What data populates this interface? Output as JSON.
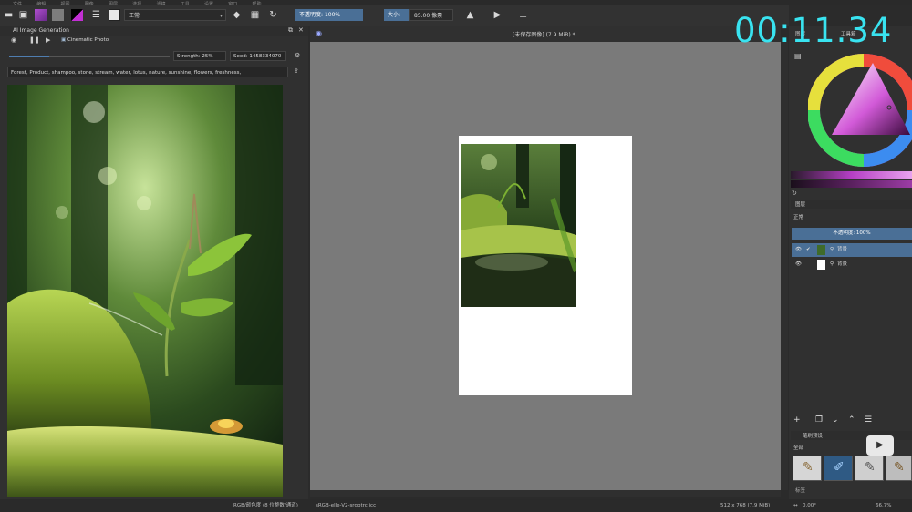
{
  "menubar": {
    "items": [
      "文件",
      "编辑",
      "视图",
      "图像",
      "图层",
      "选择",
      "滤镜",
      "工具",
      "设置",
      "窗口",
      "帮助"
    ]
  },
  "toolbar": {
    "blend_mode": "正常",
    "opacity_label": "不透明度:",
    "opacity_value": "100%",
    "size_label": "大小:",
    "size_value": "85.00 像素"
  },
  "ai_docker": {
    "title": "AI Image Generation",
    "style": "Cinematic Photo",
    "strength": "Strength: 25%",
    "seed": "Seed: 1458334070",
    "prompt": "Forest, Product, shampoo, stone, stream, water, lotus, nature, sunshine, flowers, freshness,"
  },
  "canvas": {
    "title": "[未保存图像]  (7.9 MiB) *"
  },
  "timer": "00:11.34",
  "right_panel": {
    "top_tabs": [
      "图层",
      "工具箱"
    ],
    "layers_title": "图层",
    "blend_mode": "正常",
    "opacity": "不透明度: 100%",
    "layers": [
      {
        "name": "背景",
        "selected": true
      },
      {
        "name": "背景",
        "selected": false
      }
    ],
    "brush_title": "笔刷预设",
    "brush_filter": "全部",
    "brush_tag": "标签"
  },
  "statusbar": {
    "color_mode": "RGB/颜色度 (8 位整数/通道)",
    "profile": "sRGB-elle-V2-srgbtrc.icc",
    "image_size": "512 x 768 (7.9 MiB)",
    "rotation": "0.00°",
    "zoom": "66.7%"
  },
  "colors": {
    "accent": "#4a6f96",
    "timer": "#39e3f0"
  }
}
